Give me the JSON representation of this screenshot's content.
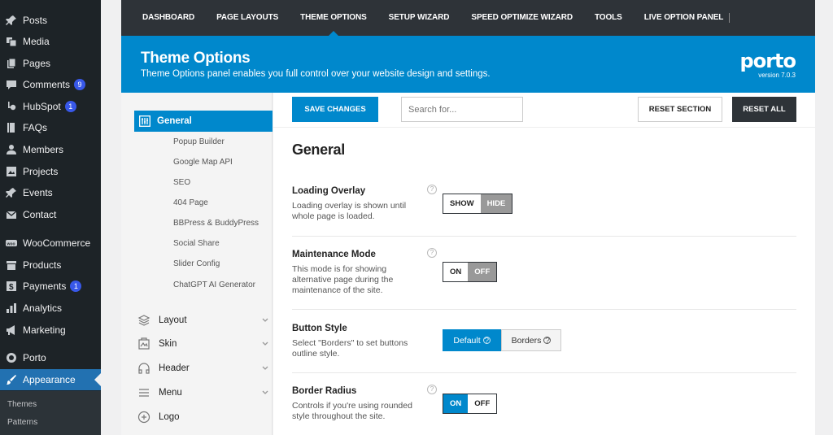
{
  "wp_sidebar": {
    "items": [
      {
        "label": "Posts",
        "icon": "pin-icon"
      },
      {
        "label": "Media",
        "icon": "media-icon"
      },
      {
        "label": "Pages",
        "icon": "pages-icon"
      },
      {
        "label": "Comments",
        "icon": "comment-icon",
        "badge": "9"
      },
      {
        "label": "HubSpot",
        "icon": "hubspot-icon",
        "badge": "1"
      },
      {
        "label": "FAQs",
        "icon": "book-icon"
      },
      {
        "label": "Members",
        "icon": "user-icon"
      },
      {
        "label": "Projects",
        "icon": "portfolio-icon"
      },
      {
        "label": "Events",
        "icon": "pin-icon"
      },
      {
        "label": "Contact",
        "icon": "mail-icon"
      },
      {
        "label": "WooCommerce",
        "icon": "woo-icon"
      },
      {
        "label": "Products",
        "icon": "archive-icon"
      },
      {
        "label": "Payments",
        "icon": "dollar-icon",
        "badge": "1"
      },
      {
        "label": "Analytics",
        "icon": "bar-chart-icon"
      },
      {
        "label": "Marketing",
        "icon": "megaphone-icon"
      },
      {
        "label": "Porto",
        "icon": "circle-icon"
      },
      {
        "label": "Appearance",
        "icon": "brush-icon"
      }
    ],
    "submenu": [
      "Themes",
      "Patterns"
    ]
  },
  "porto_nav": {
    "tabs": [
      "DASHBOARD",
      "PAGE LAYOUTS",
      "THEME OPTIONS",
      "SETUP WIZARD",
      "SPEED OPTIMIZE WIZARD",
      "TOOLS",
      "LIVE OPTION PANEL"
    ],
    "active_tab": "THEME OPTIONS"
  },
  "header": {
    "title": "Theme Options",
    "subtitle": "Theme Options panel enables you full control over your website design and settings.",
    "logo": "porto",
    "version": "version 7.0.3"
  },
  "options_nav": {
    "active_section": "General",
    "general_subsections": [
      "Popup Builder",
      "Google Map API",
      "SEO",
      "404 Page",
      "BBPress & BuddyPress",
      "Social Share",
      "Slider Config",
      "ChatGPT AI Generator"
    ],
    "sections": [
      {
        "label": "Layout",
        "icon": "layers-icon"
      },
      {
        "label": "Skin",
        "icon": "skin-icon"
      },
      {
        "label": "Header",
        "icon": "headphones-icon"
      },
      {
        "label": "Menu",
        "icon": "menu-icon"
      },
      {
        "label": "Logo",
        "icon": "plus-circle-icon"
      }
    ]
  },
  "toolbar": {
    "save_label": "SAVE CHANGES",
    "search_placeholder": "Search for...",
    "reset_section_label": "RESET SECTION",
    "reset_all_label": "RESET ALL"
  },
  "content": {
    "title": "General",
    "options": [
      {
        "label": "Loading Overlay",
        "desc": "Loading overlay is shown until whole page is loaded.",
        "on": "SHOW",
        "off": "HIDE",
        "selected": "HIDE"
      },
      {
        "label": "Maintenance Mode",
        "desc": "This mode is for showing alternative page during the maintenance of the site.",
        "on": "ON",
        "off": "OFF",
        "selected": "OFF"
      },
      {
        "label": "Button Style",
        "desc": "Select \"Borders\" to set buttons outline style.",
        "choices": [
          "Default",
          "Borders"
        ],
        "selected": "Default"
      },
      {
        "label": "Border Radius",
        "desc": "Controls if you're using rounded style throughout the site.",
        "on": "ON",
        "off": "OFF",
        "selected": "ON"
      }
    ],
    "help_glyph": "?"
  },
  "colors": {
    "accent": "#0088cc",
    "nav_dark": "#2e3338",
    "wp_sidebar": "#1d2327",
    "wp_active": "#2271b1"
  }
}
